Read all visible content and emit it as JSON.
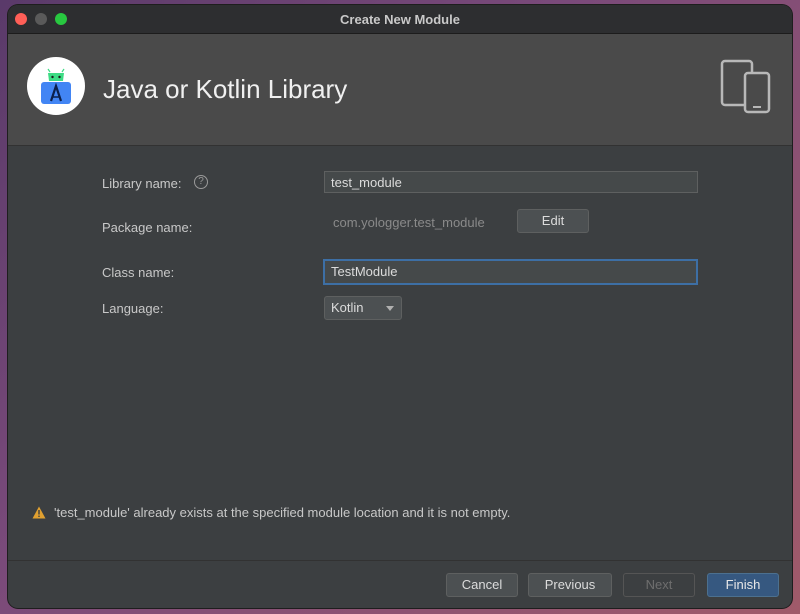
{
  "window": {
    "title": "Create New Module"
  },
  "header": {
    "title": "Java or Kotlin Library"
  },
  "form": {
    "library_name_label": "Library name:",
    "library_name_value": "test_module",
    "package_name_label": "Package name:",
    "package_name_value": "com.yologger.test_module",
    "edit_label": "Edit",
    "class_name_label": "Class name:",
    "class_name_value": "TestModule",
    "language_label": "Language:",
    "language_value": "Kotlin"
  },
  "warning": {
    "text": "'test_module' already exists at the specified module location and it is not empty."
  },
  "footer": {
    "cancel": "Cancel",
    "previous": "Previous",
    "next": "Next",
    "finish": "Finish"
  },
  "colors": {
    "accent": "#365880",
    "warning": "#e0a030",
    "android_green": "#3ddc84",
    "android_blue": "#4285f4"
  },
  "icons": [
    "android-studio-logo",
    "help-icon",
    "device-icon",
    "chevron-down-icon",
    "warning-icon"
  ]
}
